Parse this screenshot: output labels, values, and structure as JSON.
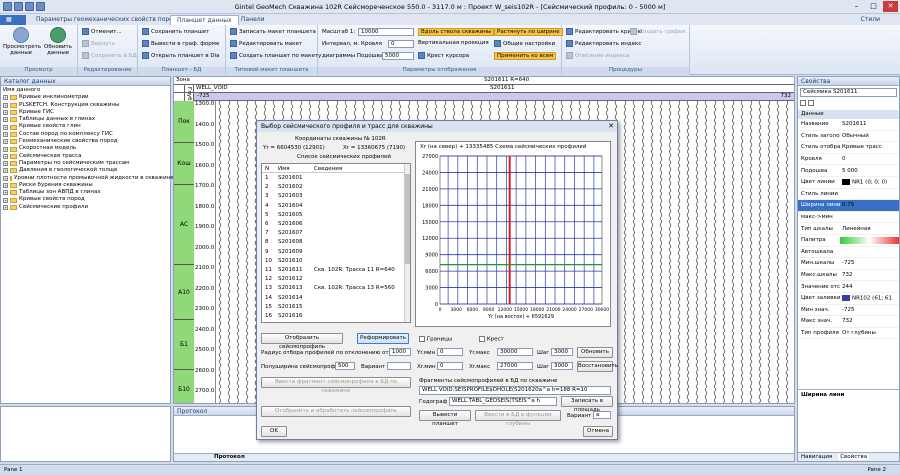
{
  "window": {
    "title": "Gintel GeoMech Скважина 102R  Сейсмореченское  550.0 - 3117.0 м : Проект W_seis102R - [Сейсмический профиль: 0 - 5000 м]",
    "styles_label": "Стили"
  },
  "tabs": [
    {
      "label": "Параметры геомеханических свойств пород"
    },
    {
      "label": "Планшет данных"
    },
    {
      "label": "Панели"
    }
  ],
  "ribbon": {
    "g1": {
      "label": "Просмотр",
      "btn1": "Просмотреть данные",
      "btn2": "Обновить данные"
    },
    "g2": {
      "label": "Редактирование",
      "b1": "Отменит...",
      "b2": "Вернуть",
      "b3": "Сохранить в БД"
    },
    "g3": {
      "label": "Планшет - БД",
      "b1": "Сохранить планшет",
      "b2": "Вывести в граф. форме",
      "b3": "Открыть планшет в Dia"
    },
    "g4": {
      "label": "Типовой макет планшета",
      "b1": "Записать макет планшета",
      "b2": "Редактировать макет",
      "b3": "Создать планшет по макету"
    },
    "g5": {
      "label": "Параметры отображения",
      "scale_label": "Масштаб 1:",
      "scale_value": "10000",
      "interval_label": "Интервал, м. Кровля",
      "roof_value": "0",
      "diag_label": "диаграммы Подошва",
      "base_value": "5000",
      "b1": "Вдоль ствола скважины",
      "b2": "Вертикальная проекция",
      "b3": "Крест курсора",
      "b4": "Растянуть по ширине",
      "b5": "Общие настройки",
      "b6": "Применить ко всем"
    },
    "g6": {
      "label": "Процедуры",
      "b1": "Редактировать кривую",
      "b2": "Создать график",
      "b3": "Редактировать индекс",
      "b4": "Описание индекса"
    }
  },
  "catalog": {
    "title": "Каталог данных",
    "root": "Имя данного",
    "items": [
      "Кривые инклинометрии",
      "PLSKETCH. Конструкция скважины",
      "Кривые ГИС",
      "Таблицы данных в глинах",
      "Кривые свойств глин",
      "Состав пород по комплексу ГИС",
      "Геомеханические свойства пород",
      "Скоростная модель",
      "Сейсмическая трасса",
      "Параметры по сейсмическим трассам",
      "Давления в геологической толще",
      "Уровни плотности промывочной жидкости в скважине",
      "Риски бурения скважины",
      "Таблицы зон АВПД в глинах",
      "Кривые свойств пород",
      "Сейсмические профили"
    ]
  },
  "plot": {
    "col1": "Зона",
    "col2": "Глуб",
    "well_label": "WELL_VOID",
    "s_label": "S201611",
    "s_header": "S201611 R=640",
    "left_val": "-725",
    "right_val": "732",
    "zones": [
      "Пок",
      "Кош",
      "АС",
      "А10",
      "Б1",
      "Б10",
      "АЧ"
    ],
    "depths": [
      "1300.0",
      "1400.0",
      "1500.0",
      "1600.0",
      "1700.0",
      "1800.0",
      "1900.0",
      "2000.0",
      "2100.0",
      "2200.0",
      "2300.0",
      "2400.0",
      "2500.0",
      "2600.0",
      "2700.0"
    ]
  },
  "dialog": {
    "title": "Выбор сейсмического профиля и трасс для скважины",
    "coords_title": "Координаты скважины № 102R",
    "yr_text": "Yr = 6604530  (12901)",
    "xr_text": "Xr = 13360675  (7190)",
    "list_title": "Список сейсмических профилей",
    "col_no": "N",
    "col_name": "Имя",
    "col_info": "Сведения",
    "rows": [
      {
        "n": "1",
        "name": "S201601",
        "info": ""
      },
      {
        "n": "2",
        "name": "S201602",
        "info": ""
      },
      {
        "n": "3",
        "name": "S201603",
        "info": ""
      },
      {
        "n": "4",
        "name": "S201604",
        "info": ""
      },
      {
        "n": "5",
        "name": "S201605",
        "info": ""
      },
      {
        "n": "6",
        "name": "S201606",
        "info": ""
      },
      {
        "n": "7",
        "name": "S201607",
        "info": ""
      },
      {
        "n": "8",
        "name": "S201608",
        "info": ""
      },
      {
        "n": "9",
        "name": "S201609",
        "info": ""
      },
      {
        "n": "10",
        "name": "S201610",
        "info": ""
      },
      {
        "n": "11",
        "name": "S201611",
        "info": "Скв. 102R: Трасса 11 R=640"
      },
      {
        "n": "12",
        "name": "S201612",
        "info": ""
      },
      {
        "n": "13",
        "name": "S201613",
        "info": "Скв. 102R: Трасса 13  R=560"
      },
      {
        "n": "14",
        "name": "S201614",
        "info": ""
      },
      {
        "n": "15",
        "name": "S201615",
        "info": ""
      },
      {
        "n": "16",
        "name": "S201616",
        "info": ""
      }
    ],
    "map_title": "Xr (на север)  + 13335485   Схема сейсмических профилей",
    "map_xlabel": "Yr (на восток) + 6591629",
    "btn_display": "Отобразить сейсмопрофиль",
    "btn_reform": "Реформировать",
    "radius_label": "Радиус отбора профилей по отклонению от",
    "radius_value": "1000",
    "half_label": "Полуширина сейсмопрофиля",
    "half_value": "500",
    "variant_label": "Вариант",
    "variant_value": "",
    "btn_insert": "Ввести фрагмент сейсмопрофиля в БД по скважине",
    "btn_process": "Отобразить и обработать сейсмопрофиль",
    "ok": "OK",
    "cancel": "Отмена",
    "grid_label": "Границы",
    "cross_label": "Крест",
    "yrmin_label": "Yr.мин",
    "yrmin_value": "0",
    "yrmax_label": "Yr.макс",
    "yrmax_value": "30000",
    "step_label": "Шаг",
    "step1_value": "3000",
    "btn_update": "Обновить",
    "xrmin_label": "Xr.мин",
    "xrmin_value": "0",
    "xrmax_label": "Xr.макс",
    "xrmax_value": "27000",
    "step2_value": "3000",
    "btn_restore": "Восстановить",
    "frag_label": "Фрагменты  сейсмопрофилей в БД по скважине",
    "frag_value": "WELL VOID.SEISPROFILE$DHOLE(S201620a^a h=188 R=10",
    "godograf_label": "Годограф",
    "godograf_value": "WELL.TABL_GEOSEIS(TSEIS^a h",
    "btn_write": "Записать в площадь",
    "btn_output": "Вывести планшет",
    "btn_insert2": "Ввести в БД в функции глубины",
    "variant2_label": "Вариант",
    "variant2_value": "a"
  },
  "props": {
    "title": "Свойства",
    "selector": "Сейсмика S201611",
    "section": "Данные",
    "rows": [
      {
        "k": "Название",
        "v": "S201611"
      },
      {
        "k": "Стиль заголо",
        "v": "Обычный"
      },
      {
        "k": "Стиль отобра",
        "v": "Кривые трасс"
      },
      {
        "k": "Кровля",
        "v": "0"
      },
      {
        "k": "Подошва",
        "v": "5 000"
      },
      {
        "k": "Цвет линии",
        "v": "NR1 (0; 0; 0)"
      },
      {
        "k": "Стиль линии",
        "v": ""
      },
      {
        "k": "Ширина лини",
        "v": "0.75"
      },
      {
        "k": "макс->мин",
        "v": ""
      },
      {
        "k": "Тип шкалы",
        "v": "Линейная"
      },
      {
        "k": "Палитра",
        "v": ""
      },
      {
        "k": "Автошкала",
        "v": ""
      },
      {
        "k": "Мин.шкалы",
        "v": "-725"
      },
      {
        "k": "Макс.шкалы",
        "v": "732"
      },
      {
        "k": "Значение отс",
        "v": "244"
      },
      {
        "k": "Цвет заливки",
        "v": "NR102 (61; 61"
      },
      {
        "k": "Мин знач.",
        "v": "-725"
      },
      {
        "k": "Макс знач.",
        "v": "732"
      },
      {
        "k": "Тип профиля",
        "v": "От глубины"
      }
    ],
    "footer": "Ширина лини",
    "tab_nav": "Навигация",
    "tab_props": "Свойства"
  },
  "protocol": {
    "title": "Протокол",
    "tab": "Протокол"
  },
  "status": {
    "left": "Pane 1",
    "right": "Pane 2"
  }
}
